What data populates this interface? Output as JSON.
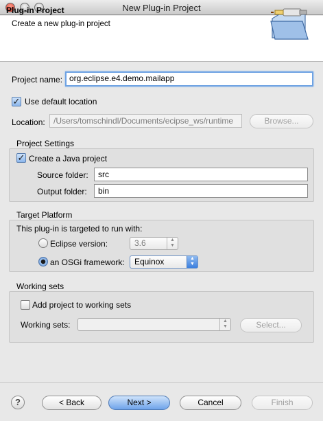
{
  "window": {
    "title": "New Plug-in Project"
  },
  "banner": {
    "title": "Plug-in Project",
    "description": "Create a new plug-in project",
    "icon": "plugin-folder-icon"
  },
  "project": {
    "name_label": "Project name:",
    "name_value": "org.eclipse.e4.demo.mailapp",
    "use_default_location_label": "Use default location",
    "use_default_location_checked": true,
    "location_label": "Location:",
    "location_value": "/Users/tomschindl/Documents/ecipse_ws/runtime",
    "browse_label": "Browse..."
  },
  "project_settings": {
    "title": "Project Settings",
    "create_java_label": "Create a Java project",
    "create_java_checked": true,
    "source_folder_label": "Source folder:",
    "source_folder_value": "src",
    "output_folder_label": "Output folder:",
    "output_folder_value": "bin"
  },
  "target_platform": {
    "title": "Target Platform",
    "intro": "This plug-in is targeted to run with:",
    "eclipse_version_label": "Eclipse version:",
    "eclipse_version_value": "3.6",
    "osgi_label": "an OSGi framework:",
    "osgi_value": "Equinox",
    "selected": "osgi"
  },
  "working_sets": {
    "title": "Working sets",
    "add_label": "Add project to working sets",
    "add_checked": false,
    "sets_label": "Working sets:",
    "select_label": "Select..."
  },
  "footer": {
    "help_glyph": "?",
    "back_label": "< Back",
    "next_label": "Next >",
    "cancel_label": "Cancel",
    "finish_label": "Finish"
  },
  "colors": {
    "focus": "#6fa3e3",
    "default_button": "#6ea3ea",
    "close_button": "#d33a2a"
  }
}
